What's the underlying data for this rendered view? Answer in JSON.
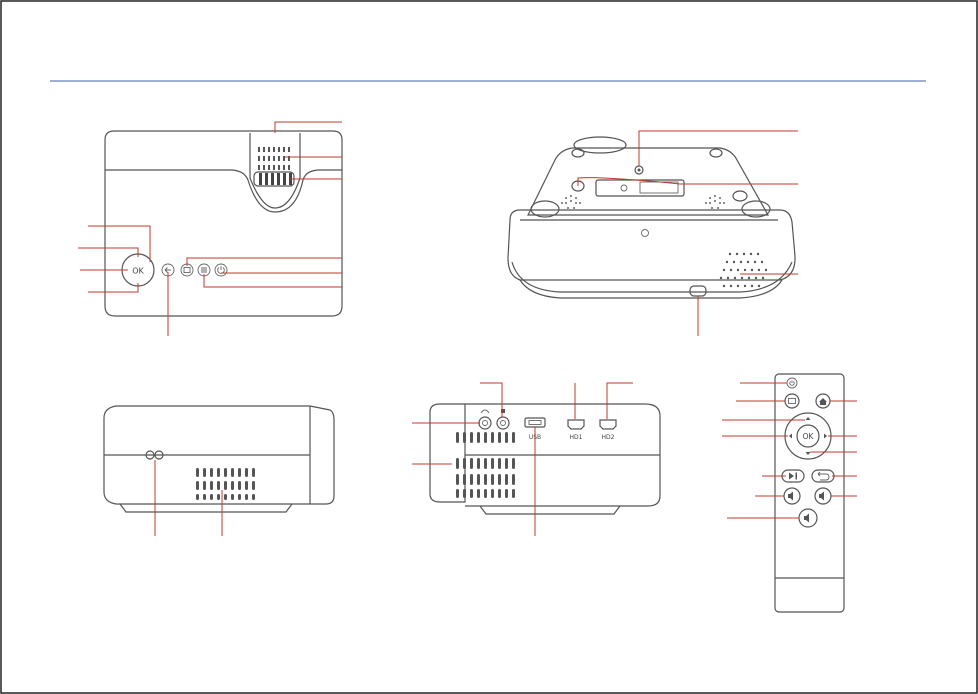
{
  "colors": {
    "rule": "#3b63a8",
    "callout": "#c0392b",
    "outline": "#555555",
    "frame": "#222222"
  },
  "labels": {
    "ok_button": "OK",
    "remote_ok": "OK",
    "usb_port": "USB",
    "hdmi1_port": "HD1",
    "hdmi2_port": "HD2"
  },
  "icons": [
    "back-arrow-icon",
    "input-source-icon",
    "menu-icon",
    "power-icon",
    "headphone-icon",
    "av-icon",
    "home-icon",
    "play-pause-icon",
    "return-icon",
    "volume-down-icon",
    "volume-up-icon",
    "mute-icon"
  ]
}
